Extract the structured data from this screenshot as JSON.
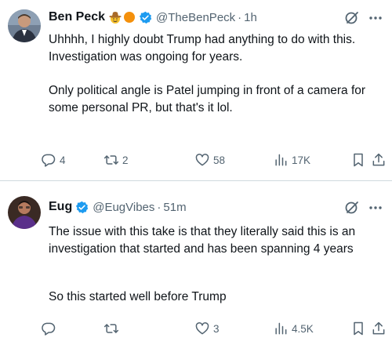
{
  "tweets": [
    {
      "name": "Ben Peck",
      "handle": "@TheBenPeck",
      "dot": "·",
      "time": "1h",
      "text_p1": "Uhhhh, I highly doubt Trump had anything to do with this. Investigation was ongoing for years.",
      "text_p2": "Only political angle is Patel jumping in front of a camera for some personal PR, but that's it lol.",
      "replies": "4",
      "retweets": "2",
      "likes": "58",
      "views": "17K",
      "name_emojis": [
        "cowboy-hat-face",
        "orange-circle"
      ]
    },
    {
      "name": "Eug",
      "handle": "@EugVibes",
      "dot": "·",
      "time": "51m",
      "text_p1": "The issue with this take is that they literally said this is an investigation that started and has been spanning 4 years",
      "text_p2": "So this started well before Trump",
      "replies": "",
      "retweets": "",
      "likes": "3",
      "views": "4.5K"
    }
  ],
  "colors": {
    "text": "#0f1419",
    "secondary": "#536471",
    "verified": "#1d9bf0",
    "divider": "#cfd9de"
  },
  "icons": [
    "grok-icon",
    "more-icon",
    "reply-icon",
    "retweet-icon",
    "like-icon",
    "views-icon",
    "bookmark-icon",
    "share-icon",
    "verified-badge-icon"
  ]
}
